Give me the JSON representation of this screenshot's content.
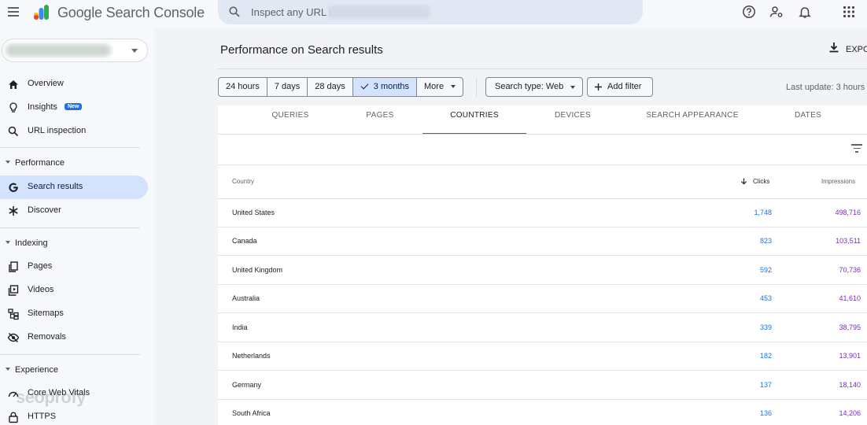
{
  "app": {
    "brand": "Google Search Console"
  },
  "search": {
    "placeholder": "Inspect any URL in"
  },
  "property": {
    "selected": ""
  },
  "sidebar": {
    "items": [
      {
        "label": "Overview",
        "icon": "home-icon"
      },
      {
        "label": "Insights",
        "icon": "lightbulb-icon",
        "badge": "New"
      },
      {
        "label": "URL inspection",
        "icon": "search-icon"
      }
    ],
    "sections": [
      {
        "label": "Performance",
        "items": [
          {
            "label": "Search results",
            "icon": "google-g-icon",
            "active": true
          },
          {
            "label": "Discover",
            "icon": "asterisk-icon"
          }
        ]
      },
      {
        "label": "Indexing",
        "items": [
          {
            "label": "Pages",
            "icon": "pages-icon"
          },
          {
            "label": "Videos",
            "icon": "video-icon"
          },
          {
            "label": "Sitemaps",
            "icon": "sitemap-icon"
          },
          {
            "label": "Removals",
            "icon": "eye-off-icon"
          }
        ]
      },
      {
        "label": "Experience",
        "items": [
          {
            "label": "Core Web Vitals",
            "icon": "gauge-icon"
          },
          {
            "label": "HTTPS",
            "icon": "lock-icon"
          }
        ]
      }
    ]
  },
  "watermark": "seoprofy",
  "main": {
    "title": "Performance on Search results",
    "export_label": "EXPO",
    "date_chips": [
      "24 hours",
      "7 days",
      "28 days",
      "3 months"
    ],
    "selected_chip": "3 months",
    "more_label": "More",
    "search_type_label": "Search type: Web",
    "add_filter_label": "Add filter",
    "last_update": "Last update: 3 hours"
  },
  "tabs": [
    "QUERIES",
    "PAGES",
    "COUNTRIES",
    "DEVICES",
    "SEARCH APPEARANCE",
    "DATES"
  ],
  "active_tab": "COUNTRIES",
  "table": {
    "headers": {
      "country": "Country",
      "clicks": "Clicks",
      "impressions": "Impressions"
    },
    "sort": "clicks-descending",
    "rows": [
      {
        "country": "United States",
        "clicks": "1,748",
        "impressions": "498,716"
      },
      {
        "country": "Canada",
        "clicks": "823",
        "impressions": "103,511"
      },
      {
        "country": "United Kingdom",
        "clicks": "592",
        "impressions": "70,736"
      },
      {
        "country": "Australia",
        "clicks": "453",
        "impressions": "41,610"
      },
      {
        "country": "India",
        "clicks": "339",
        "impressions": "38,795"
      },
      {
        "country": "Netherlands",
        "clicks": "182",
        "impressions": "13,901"
      },
      {
        "country": "Germany",
        "clicks": "137",
        "impressions": "18,140"
      },
      {
        "country": "South Africa",
        "clicks": "136",
        "impressions": "14,206"
      }
    ]
  },
  "colors": {
    "accent_blue": "#1a73e8",
    "impressions_purple": "#7b2cbf",
    "active_bg": "#d3e3fd"
  }
}
